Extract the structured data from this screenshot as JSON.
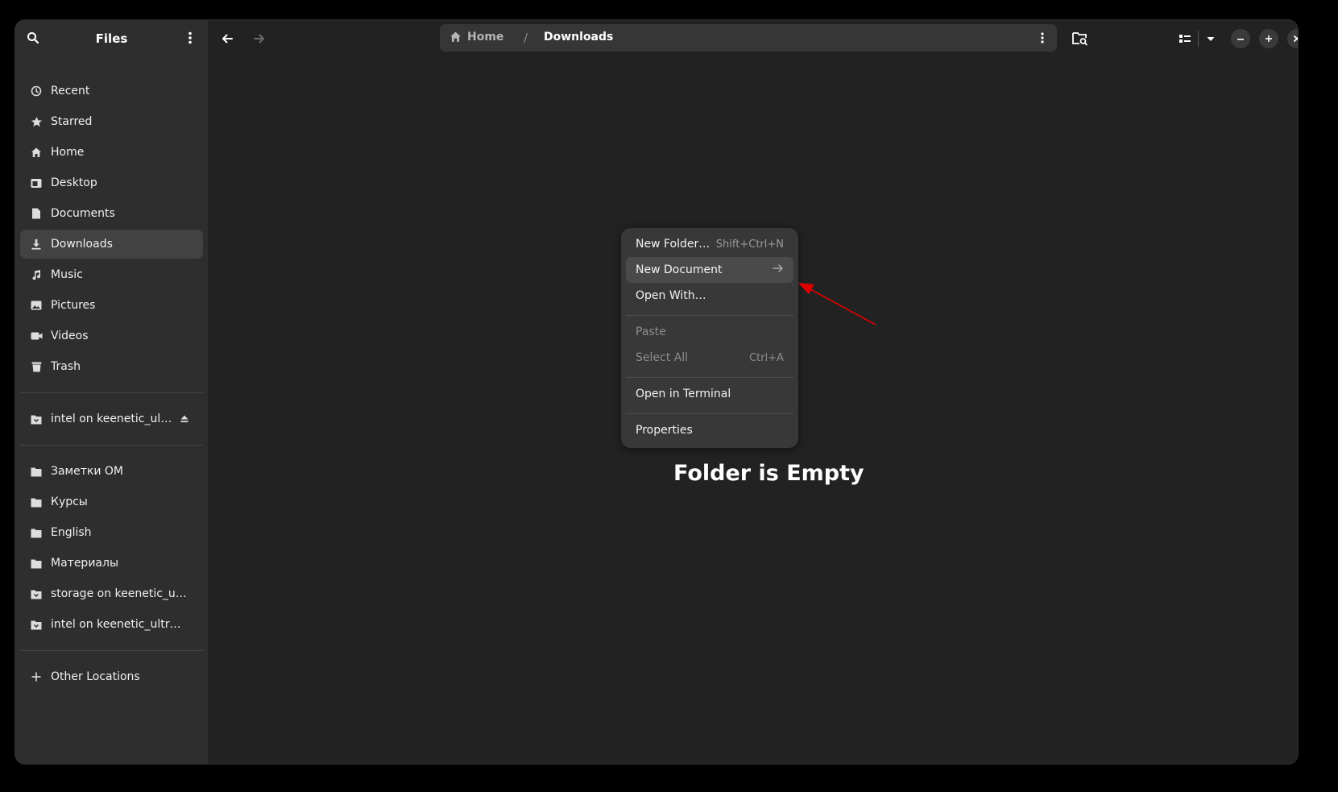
{
  "app": {
    "title": "Files"
  },
  "sidebar": {
    "items": [
      {
        "label": "Recent",
        "icon": "clock-icon"
      },
      {
        "label": "Starred",
        "icon": "star-icon"
      },
      {
        "label": "Home",
        "icon": "home-icon"
      },
      {
        "label": "Desktop",
        "icon": "desktop-folder-icon"
      },
      {
        "label": "Documents",
        "icon": "document-icon"
      },
      {
        "label": "Downloads",
        "icon": "download-icon",
        "active": true
      },
      {
        "label": "Music",
        "icon": "music-icon"
      },
      {
        "label": "Pictures",
        "icon": "picture-icon"
      },
      {
        "label": "Videos",
        "icon": "video-icon"
      },
      {
        "label": "Trash",
        "icon": "trash-icon"
      }
    ],
    "mounts": [
      {
        "label": "intel on keenetic_ul…",
        "icon": "network-folder-icon",
        "eject_icon": "eject-icon"
      }
    ],
    "bookmarks": [
      {
        "label": "Заметки ОМ",
        "icon": "folder-icon"
      },
      {
        "label": "Курсы",
        "icon": "folder-icon"
      },
      {
        "label": "English",
        "icon": "folder-icon"
      },
      {
        "label": "Материалы",
        "icon": "folder-icon"
      },
      {
        "label": "storage on keenetic_ult…",
        "icon": "network-folder-icon"
      },
      {
        "label": "intel on keenetic_ultra.l…",
        "icon": "network-folder-icon"
      }
    ],
    "other_locations": {
      "label": "Other Locations",
      "icon": "plus-icon"
    }
  },
  "pathbar": {
    "home_label": "Home",
    "separator": "/",
    "current": "Downloads"
  },
  "content": {
    "empty_title": "Folder is Empty"
  },
  "context_menu": {
    "new_folder": {
      "label": "New Folder…",
      "accel": "Shift+Ctrl+N"
    },
    "new_document": {
      "label": "New Document"
    },
    "open_with": {
      "label": "Open With…"
    },
    "paste": {
      "label": "Paste"
    },
    "select_all": {
      "label": "Select All",
      "accel": "Ctrl+A"
    },
    "open_terminal": {
      "label": "Open in Terminal"
    },
    "properties": {
      "label": "Properties"
    }
  },
  "colors": {
    "window_bg": "#222222",
    "sidebar_bg": "#2e2e2e",
    "menu_bg": "#383838",
    "annotation_arrow": "#e00000"
  }
}
